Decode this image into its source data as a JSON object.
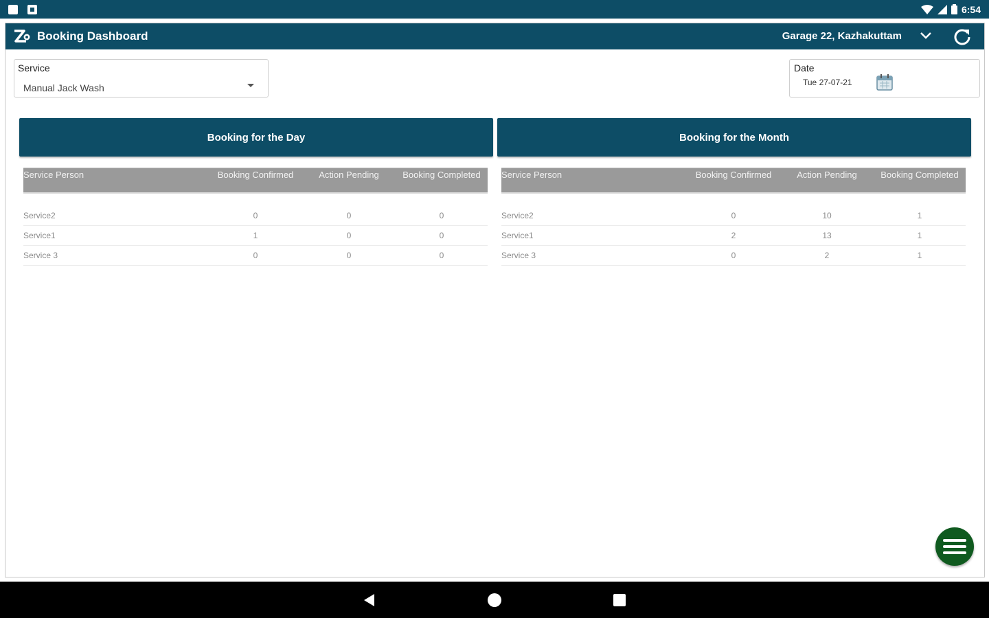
{
  "status_bar": {
    "time": "6:54",
    "icons": [
      "sim-icon",
      "notification-icon",
      "wifi-icon",
      "cell-signal-icon",
      "battery-icon"
    ]
  },
  "app_bar": {
    "title": "Booking Dashboard",
    "garage": "Garage 22, Kazhakuttam",
    "icons": [
      "app-logo-icon",
      "chevron-down-icon",
      "refresh-icon"
    ]
  },
  "filters": {
    "service": {
      "label": "Service",
      "value": "Manual Jack Wash"
    },
    "date": {
      "label": "Date",
      "value": "Tue 27-07-21"
    }
  },
  "day_panel": {
    "title": "Booking for the Day",
    "columns": [
      "Service Person",
      "Booking Confirmed",
      "Action Pending",
      "Booking Completed"
    ],
    "rows": [
      {
        "person": "Service2",
        "confirmed": "0",
        "pending": "0",
        "completed": "0"
      },
      {
        "person": "Service1",
        "confirmed": "1",
        "pending": "0",
        "completed": "0"
      },
      {
        "person": "Service 3",
        "confirmed": "0",
        "pending": "0",
        "completed": "0"
      }
    ]
  },
  "month_panel": {
    "title": "Booking for the Month",
    "columns": [
      "Service Person",
      "Booking Confirmed",
      "Action Pending",
      "Booking Completed"
    ],
    "rows": [
      {
        "person": "Service2",
        "confirmed": "0",
        "pending": "10",
        "completed": "1"
      },
      {
        "person": "Service1",
        "confirmed": "2",
        "pending": "13",
        "completed": "1"
      },
      {
        "person": "Service 3",
        "confirmed": "0",
        "pending": "2",
        "completed": "1"
      }
    ]
  },
  "colors": {
    "primary": "#0d4d66",
    "fab": "#0f5a1f",
    "table_header": "#9a9a9a"
  }
}
